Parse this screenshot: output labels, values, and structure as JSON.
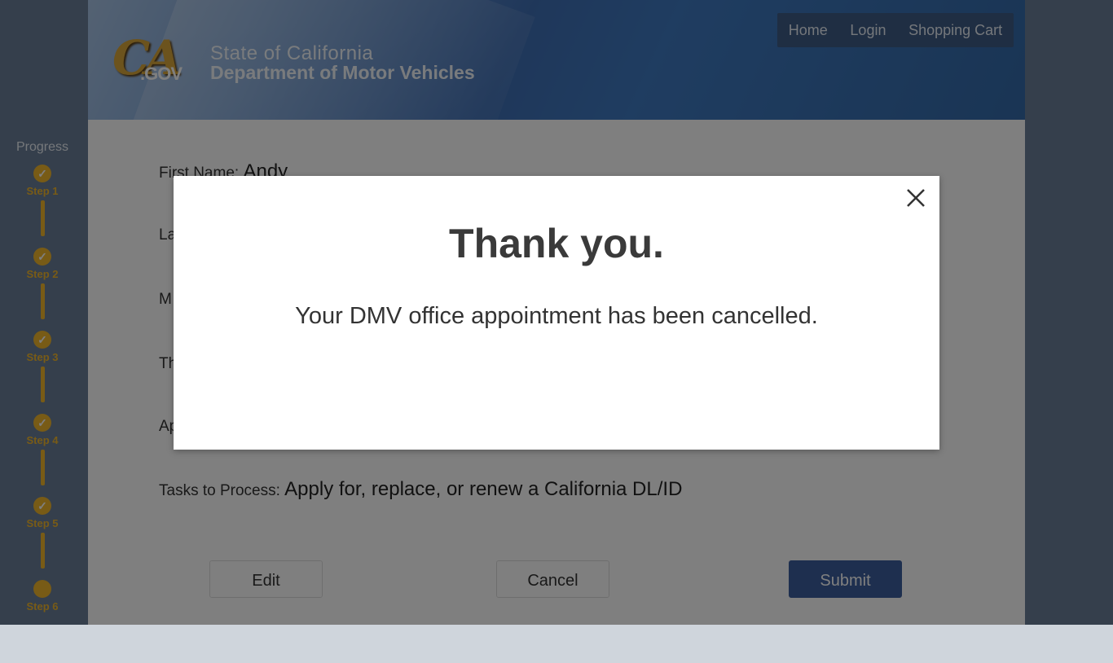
{
  "header": {
    "logo_text": "CA",
    "logo_sub": ".GOV",
    "agency_line1": "State of California",
    "agency_line2": "Department of Motor Vehicles",
    "nav": [
      "Home",
      "Login",
      "Shopping Cart"
    ]
  },
  "progress": {
    "title": "Progress",
    "steps": [
      {
        "label": "Step 1",
        "done": true
      },
      {
        "label": "Step 2",
        "done": true
      },
      {
        "label": "Step 3",
        "done": true
      },
      {
        "label": "Step 4",
        "done": true
      },
      {
        "label": "Step 5",
        "done": true
      },
      {
        "label": "Step 6",
        "done": false
      }
    ]
  },
  "form": {
    "first_name_label": "First Name:",
    "first_name_value": "Andy",
    "partial_label_2": "La",
    "partial_label_3": "M",
    "partial_label_4": "Th",
    "partial_label_5": "Ap",
    "tasks_label": "Tasks to Process:",
    "tasks_value": "Apply for, replace, or renew a California DL/ID"
  },
  "buttons": {
    "edit": "Edit",
    "cancel": "Cancel",
    "submit": "Submit"
  },
  "modal": {
    "title": "Thank you.",
    "message": "Your DMV office appointment has been cancelled."
  },
  "colors": {
    "accent_gold": "#f0b62c",
    "header_blue": "#3f6fb5",
    "primary_button": "#3c5f9e"
  }
}
